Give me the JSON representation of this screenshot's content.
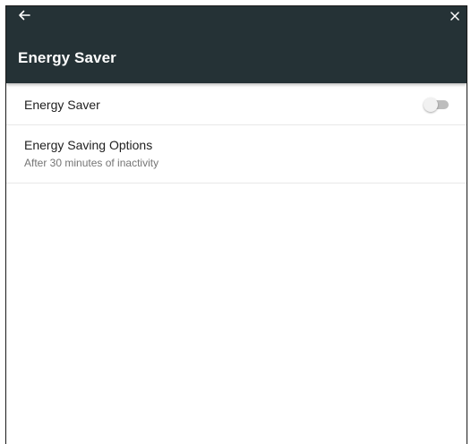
{
  "header": {
    "title": "Energy Saver",
    "back_icon": "arrow-left-icon",
    "close_icon": "close-icon",
    "background": "#253236"
  },
  "settings": {
    "energy_saver": {
      "label": "Energy Saver",
      "enabled": false
    },
    "energy_saving_options": {
      "label": "Energy Saving Options",
      "summary": "After 30 minutes of inactivity"
    }
  }
}
